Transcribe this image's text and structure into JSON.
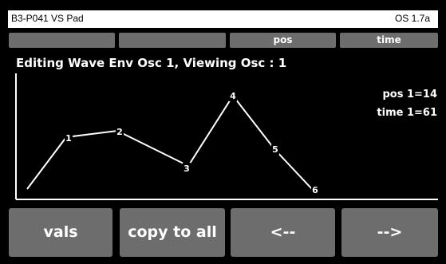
{
  "titlebar": {
    "title": "B3-P041 VS Pad",
    "version": "OS 1.7a"
  },
  "tabs": [
    {
      "label": ""
    },
    {
      "label": ""
    },
    {
      "label": "pos"
    },
    {
      "label": "time"
    }
  ],
  "heading": "Editing Wave Env Osc 1, Viewing Osc : 1",
  "readout": {
    "pos": "pos 1=14",
    "time": "time 1=61"
  },
  "envelope": {
    "points": [
      {
        "label": ""
      },
      {
        "label": "1"
      },
      {
        "label": "2"
      },
      {
        "label": "3"
      },
      {
        "label": "4"
      },
      {
        "label": "5"
      },
      {
        "label": "6"
      }
    ]
  },
  "buttons": {
    "vals": "vals",
    "copy": "copy to all",
    "prev": "<--",
    "next": "-->"
  }
}
